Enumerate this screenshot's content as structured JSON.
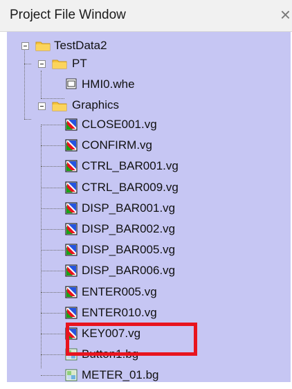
{
  "window": {
    "title": "Project File Window",
    "close_glyph": "×"
  },
  "tree": {
    "root": {
      "label": "TestData2",
      "icon": "folder-icon",
      "expanded": true
    },
    "pt_folder": {
      "label": "PT",
      "icon": "folder-icon",
      "expanded": true
    },
    "pt_file": {
      "label": "HMI0.whe",
      "icon": "screen-file-icon"
    },
    "graphics_folder": {
      "label": "Graphics",
      "icon": "folder-icon",
      "expanded": true
    },
    "graphics_items": [
      {
        "label": "CLOSE001.vg",
        "icon": "vector-graphic-icon"
      },
      {
        "label": "CONFIRM.vg",
        "icon": "vector-graphic-icon"
      },
      {
        "label": "CTRL_BAR001.vg",
        "icon": "vector-graphic-icon"
      },
      {
        "label": "CTRL_BAR009.vg",
        "icon": "vector-graphic-icon"
      },
      {
        "label": "DISP_BAR001.vg",
        "icon": "vector-graphic-icon"
      },
      {
        "label": "DISP_BAR002.vg",
        "icon": "vector-graphic-icon"
      },
      {
        "label": "DISP_BAR005.vg",
        "icon": "vector-graphic-icon"
      },
      {
        "label": "DISP_BAR006.vg",
        "icon": "vector-graphic-icon"
      },
      {
        "label": "ENTER005.vg",
        "icon": "vector-graphic-icon"
      },
      {
        "label": "ENTER010.vg",
        "icon": "vector-graphic-icon"
      },
      {
        "label": "KEY007.vg",
        "icon": "vector-graphic-icon"
      },
      {
        "label": "Button1.bg",
        "icon": "bitmap-graphic-icon"
      },
      {
        "label": "METER_01.bg",
        "icon": "bitmap-graphic-icon"
      }
    ]
  },
  "colors": {
    "panel_bg": "#c6c6f3",
    "highlight": "#e8141e",
    "folder": "#f6c43b"
  }
}
